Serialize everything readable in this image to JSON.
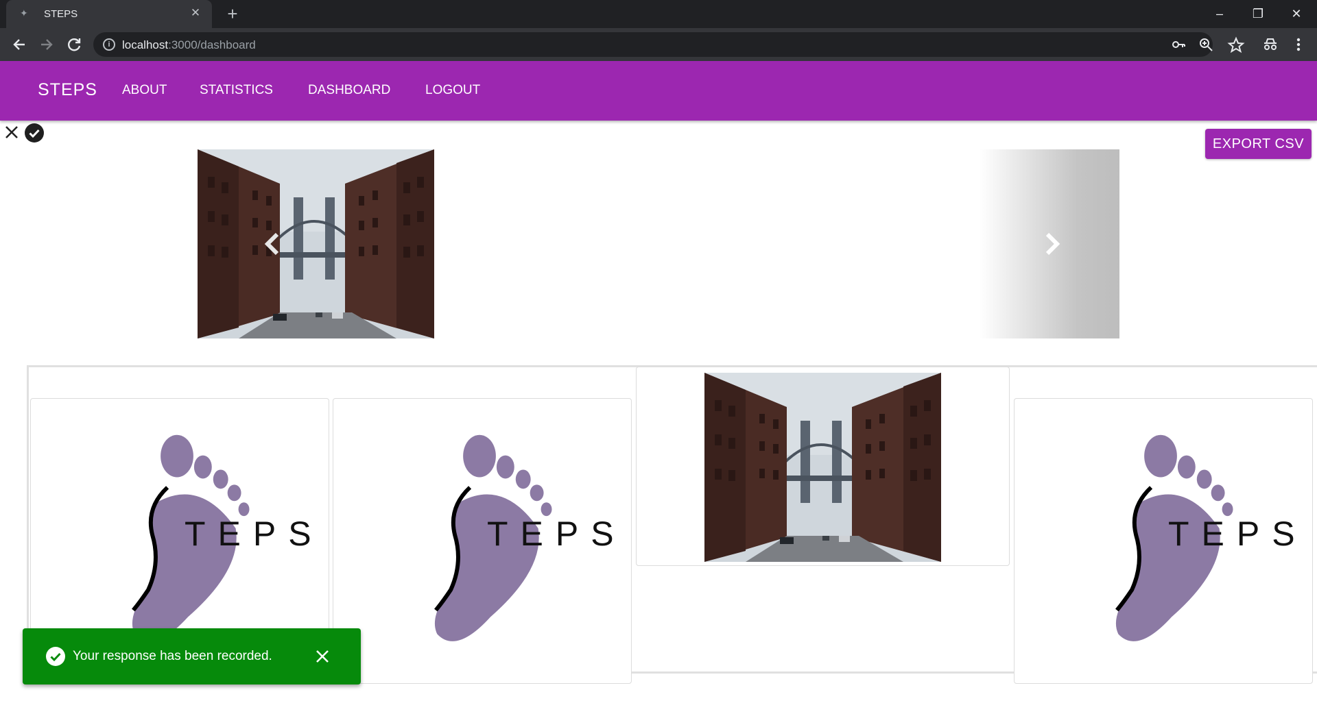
{
  "browser": {
    "tab_title": "STEPS",
    "tab_close": "✕",
    "new_tab": "+",
    "url_host": "localhost",
    "url_rest": ":3000/dashboard",
    "window_min": "–",
    "window_max": "❐",
    "window_close": "✕",
    "icons": [
      "back-icon",
      "forward-icon",
      "reload-icon",
      "info-icon",
      "key-icon",
      "zoom-icon",
      "star-icon",
      "incognito-icon",
      "menu-icon"
    ]
  },
  "appbar": {
    "brand": "STEPS",
    "links": [
      "ABOUT",
      "STATISTICS",
      "DASHBOARD",
      "LOGOUT"
    ],
    "color": "#9c27b0"
  },
  "toolbar": {
    "export_label": "EXPORT CSV"
  },
  "gallery": {
    "logo_text": "TEPS",
    "logo_color": "#8c7aa4"
  },
  "snackbar": {
    "message": "Your response has been recorded.",
    "color": "#068a0b"
  }
}
